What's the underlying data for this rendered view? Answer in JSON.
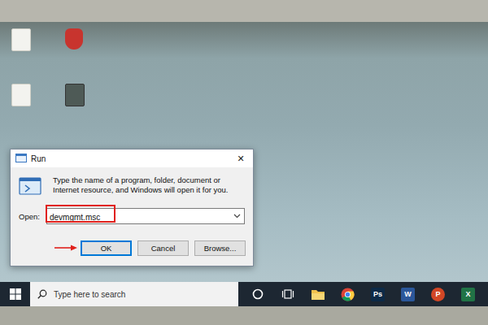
{
  "dialog": {
    "title": "Run",
    "close": "✕",
    "description": "Type the name of a program, folder, document or Internet resource, and Windows will open it for you.",
    "open_label": "Open:",
    "open_value": "devmgmt.msc",
    "buttons": [
      {
        "label": "OK",
        "default": true
      },
      {
        "label": "Cancel",
        "default": false
      },
      {
        "label": "Browse...",
        "default": false
      }
    ]
  },
  "annotations": [
    {
      "kind": "box"
    },
    {
      "kind": "arrow"
    }
  ],
  "taskbar": {
    "search_placeholder": "Type here to search",
    "apps": [
      {
        "kind": "cortana"
      },
      {
        "kind": "task-view"
      },
      {
        "kind": "explorer"
      },
      {
        "kind": "chrome"
      },
      {
        "kind": "tile",
        "glyph": "Ps",
        "color": "#0d2a47"
      },
      {
        "kind": "tile",
        "glyph": "W",
        "color": "#2b579a"
      },
      {
        "kind": "round",
        "glyph": "P",
        "color": "#d24726"
      },
      {
        "kind": "tile",
        "glyph": "X",
        "color": "#217346"
      }
    ]
  }
}
